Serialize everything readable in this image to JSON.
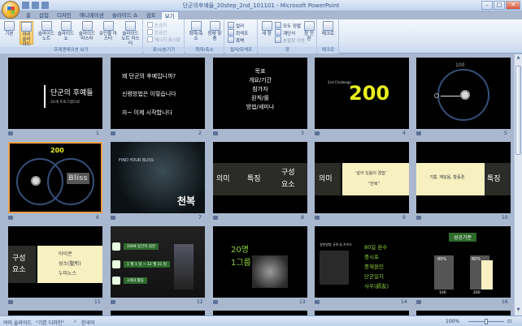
{
  "window": {
    "title": "단군의후예들_20step_2nd_101101 - Microsoft PowerPoint",
    "min": "–",
    "max": "□",
    "close": "✕"
  },
  "tabs": [
    "홈",
    "삽입",
    "디자인",
    "애니메이션",
    "슬라이드 쇼",
    "검토",
    "보기"
  ],
  "active_tab": "보기",
  "ribbon": {
    "groups": [
      {
        "label": "프레젠테이션 보기",
        "buttons": [
          "기본",
          "여러 슬라이드",
          "슬라이드 노트",
          "슬라이드 쇼",
          "슬라이드 마스터",
          "유인물 마스터",
          "슬라이드 노트 마스터"
        ]
      },
      {
        "label": "표시/숨기기",
        "checks": [
          "눈금자",
          "눈금선",
          "메시지 표시줄"
        ]
      },
      {
        "label": "확대/축소",
        "buttons": [
          "확대/축소",
          "창에 맞춤"
        ]
      },
      {
        "label": "컬러/회색조",
        "options": [
          "컬러",
          "회색조",
          "흑백"
        ]
      },
      {
        "label": "창",
        "buttons": [
          "새 창"
        ],
        "small": [
          "모두 정렬",
          "계단식",
          "분할창 이동"
        ],
        "switch": "창 전환"
      },
      {
        "label": "매크로",
        "buttons": [
          "매크로"
        ]
      }
    ]
  },
  "slides": [
    {
      "n": "1",
      "lines": [
        "단군의 후예들",
        "20개 프로그램으로"
      ]
    },
    {
      "n": "2",
      "lines": [
        "왜 단군의 후예입니까?",
        "신령방법은 이렇습니다",
        "자~ 이제 시작합니다"
      ]
    },
    {
      "n": "3",
      "lines": [
        "목표",
        "개요/기간",
        "참가자",
        "원칙/룰",
        "방법/세미나"
      ]
    },
    {
      "n": "4",
      "lines": [
        "2nd Challenge",
        "200"
      ]
    },
    {
      "n": "5",
      "lines": [
        "100"
      ]
    },
    {
      "n": "6",
      "lines": [
        "200",
        "Bliss"
      ]
    },
    {
      "n": "7",
      "lines": [
        "천복",
        "FIND YOUR BLISS"
      ]
    },
    {
      "n": "8",
      "lines": [
        "의미",
        "특징",
        "구성",
        "요소"
      ]
    },
    {
      "n": "9",
      "lines": [
        "의미",
        "'살아 있음의 경험'",
        "\"천복\""
      ]
    },
    {
      "n": "10",
      "lines": [
        "기쁨, 재달음, 황홀경",
        "특징"
      ]
    },
    {
      "n": "11",
      "lines": [
        "구성",
        "요소",
        "아이콘",
        "성소(聖所)",
        "누미노스"
      ]
    },
    {
      "n": "12",
      "lines": [
        "2009 일간지 실천",
        "1 월 1 일 ~ 12 월 31 일",
        "3개의 활동"
      ]
    },
    {
      "n": "13",
      "lines": [
        "20명",
        "1그룹"
      ]
    },
    {
      "n": "14",
      "lines": [
        "실천방법 규칙 & 가이드"
      ]
    },
    {
      "n": "15",
      "lines": [
        "80일 완수",
        "중시포",
        "중재원인",
        "단군일지",
        "사우(師友)"
      ]
    },
    {
      "n": "16",
      "lines": [
        "성공기준",
        "80%",
        "80%",
        "100",
        "200"
      ]
    }
  ],
  "status": {
    "view": "여러 슬라이드",
    "theme": "\"기본 디자인\"",
    "lang": "한국어",
    "zoom": "100%"
  },
  "colors": {
    "ribbon": "#dbe6f5",
    "sorter_bg": "#a9b8cf",
    "slide_bg": "#000000",
    "accent_yellow": "#e8f01e",
    "green_text": "#8fd33b",
    "cream_box": "#f7f1c2",
    "selected_border": "#f0a24a"
  }
}
